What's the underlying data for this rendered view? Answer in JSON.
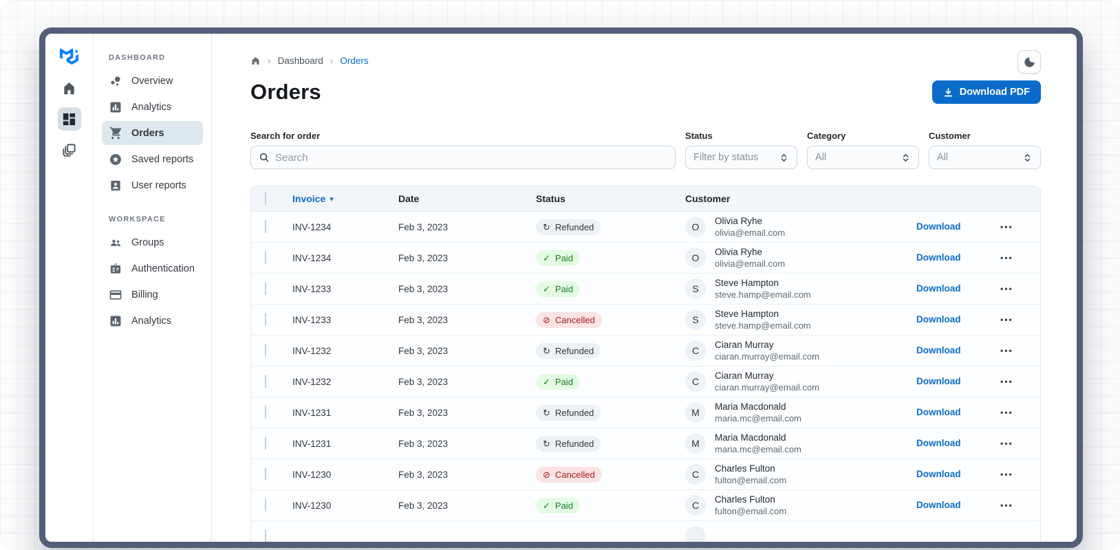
{
  "colors": {
    "primary": "#0B6BCB",
    "frame": "#535E78",
    "nav_selected_bg": "#DDE7EE"
  },
  "sidebar": {
    "rail": [
      {
        "icon": "home"
      },
      {
        "icon": "dashboard",
        "selected": true
      },
      {
        "icon": "layers"
      }
    ],
    "sections": [
      {
        "label": "DASHBOARD",
        "items": [
          {
            "label": "Overview",
            "icon": "bubble"
          },
          {
            "label": "Analytics",
            "icon": "chart"
          },
          {
            "label": "Orders",
            "icon": "cart",
            "selected": true
          },
          {
            "label": "Saved reports",
            "icon": "star"
          },
          {
            "label": "User reports",
            "icon": "person"
          }
        ]
      },
      {
        "label": "WORKSPACE",
        "items": [
          {
            "label": "Groups",
            "icon": "groups"
          },
          {
            "label": "Authentication",
            "icon": "badge"
          },
          {
            "label": "Billing",
            "icon": "card"
          },
          {
            "label": "Analytics",
            "icon": "chart"
          }
        ]
      }
    ]
  },
  "breadcrumb": {
    "items": [
      "Dashboard",
      "Orders"
    ]
  },
  "header": {
    "title": "Orders",
    "download_button": "Download PDF"
  },
  "filters": {
    "search": {
      "label": "Search for order",
      "placeholder": "Search"
    },
    "selects": [
      {
        "label": "Status",
        "value": "Filter by status"
      },
      {
        "label": "Category",
        "value": "All"
      },
      {
        "label": "Customer",
        "value": "All"
      }
    ]
  },
  "table": {
    "columns": [
      "Invoice",
      "Date",
      "Status",
      "Customer"
    ],
    "sorted_column": "Invoice",
    "sort_arrow": "▾",
    "rows": [
      {
        "invoice": "INV-1234",
        "date": "Feb 3, 2023",
        "status": "Refunded",
        "initial": "O",
        "name": "Olivia Ryhe",
        "email": "olivia@email.com"
      },
      {
        "invoice": "INV-1234",
        "date": "Feb 3, 2023",
        "status": "Paid",
        "initial": "O",
        "name": "Olivia Ryhe",
        "email": "olivia@email.com"
      },
      {
        "invoice": "INV-1233",
        "date": "Feb 3, 2023",
        "status": "Paid",
        "initial": "S",
        "name": "Steve Hampton",
        "email": "steve.hamp@email.com"
      },
      {
        "invoice": "INV-1233",
        "date": "Feb 3, 2023",
        "status": "Cancelled",
        "initial": "S",
        "name": "Steve Hampton",
        "email": "steve.hamp@email.com"
      },
      {
        "invoice": "INV-1232",
        "date": "Feb 3, 2023",
        "status": "Refunded",
        "initial": "C",
        "name": "Ciaran Murray",
        "email": "ciaran.murray@email.com"
      },
      {
        "invoice": "INV-1232",
        "date": "Feb 3, 2023",
        "status": "Paid",
        "initial": "C",
        "name": "Ciaran Murray",
        "email": "ciaran.murray@email.com"
      },
      {
        "invoice": "INV-1231",
        "date": "Feb 3, 2023",
        "status": "Refunded",
        "initial": "M",
        "name": "Maria Macdonald",
        "email": "maria.mc@email.com"
      },
      {
        "invoice": "INV-1231",
        "date": "Feb 3, 2023",
        "status": "Refunded",
        "initial": "M",
        "name": "Maria Macdonald",
        "email": "maria.mc@email.com"
      },
      {
        "invoice": "INV-1230",
        "date": "Feb 3, 2023",
        "status": "Cancelled",
        "initial": "C",
        "name": "Charles Fulton",
        "email": "fulton@email.com"
      },
      {
        "invoice": "INV-1230",
        "date": "Feb 3, 2023",
        "status": "Paid",
        "initial": "C",
        "name": "Charles Fulton",
        "email": "fulton@email.com"
      },
      {
        "invoice": "",
        "date": "",
        "status": "",
        "initial": "",
        "name": "",
        "email": "",
        "partial": true
      }
    ]
  },
  "status_chips": {
    "Paid": {
      "icon": "✓",
      "color": "#1F7A1F",
      "bg": "#E3FBE3"
    },
    "Refunded": {
      "icon": "↻",
      "color": "#32383E",
      "bg": "#EDF0F4"
    },
    "Cancelled": {
      "icon": "⊘",
      "color": "#A51818",
      "bg": "#FCE4E4"
    }
  },
  "row_actions": {
    "download_label": "Download",
    "menu_icon": "•••"
  }
}
